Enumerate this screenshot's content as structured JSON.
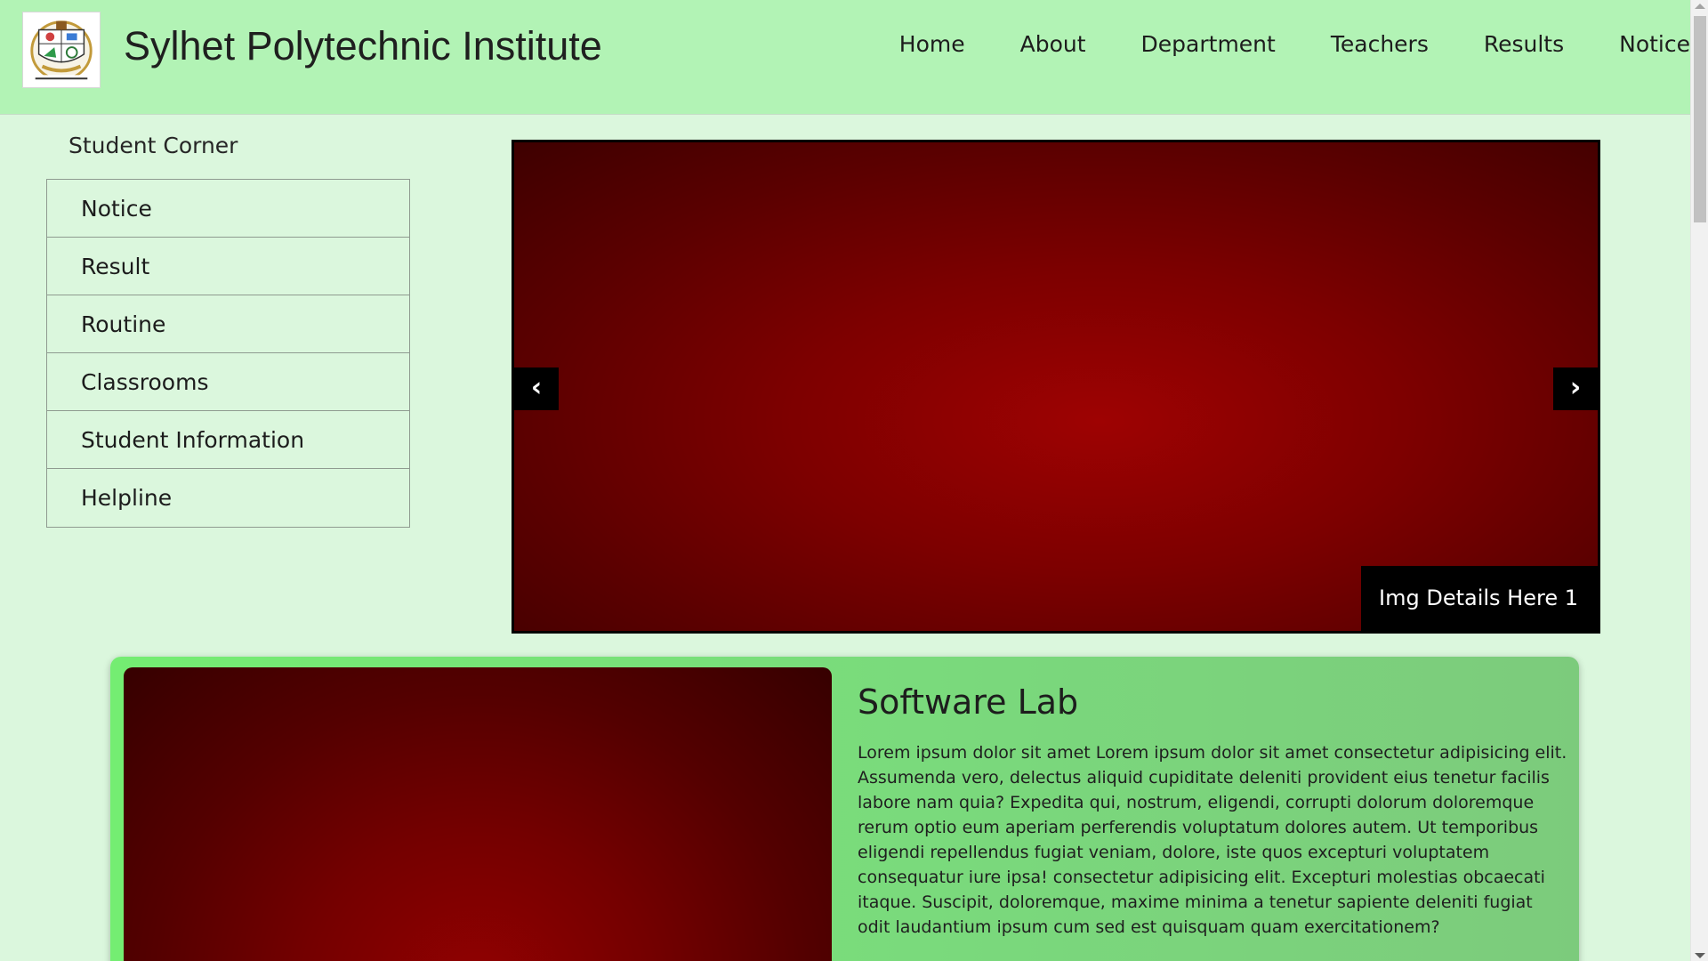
{
  "header": {
    "title": "Sylhet Polytechnic Institute",
    "logo_icon": "institute-logo",
    "nav": [
      "Home",
      "About",
      "Department",
      "Teachers",
      "Results",
      "Notice"
    ]
  },
  "sidebar": {
    "title": "Student Corner",
    "items": [
      "Notice",
      "Result",
      "Routine",
      "Classrooms",
      "Student Information",
      "Helpline"
    ]
  },
  "slider": {
    "prev_icon": "‹",
    "next_icon": "›",
    "caption": "Img Details Here 1"
  },
  "lab": {
    "title": "Software Lab",
    "description": "Lorem ipsum dolor sit amet Lorem ipsum dolor sit amet consectetur adipisicing elit. Assumenda vero, delectus aliquid cupiditate deleniti provident eius tenetur facilis labore nam quia? Expedita qui, nostrum, eligendi, corrupti dolorum doloremque rerum optio eum aperiam perferendis voluptatum dolores autem. Ut temporibus eligendi repellendus fugiat veniam, dolore, iste quos excepturi voluptatem consequatur iure ipsa! consectetur adipisicing elit. Excepturi molestias obcaecati itaque. Suscipit, doloremque, maxime minima a tenetur sapiente deleniti fugiat odit laudantium ipsum cum sed est quisquam quam exercitationem?"
  },
  "colors": {
    "header_bg": "#b2f3b5",
    "page_bg": "#dbf7dd",
    "card_bg": "#7ada7c",
    "slide_red": "#9e0202"
  }
}
